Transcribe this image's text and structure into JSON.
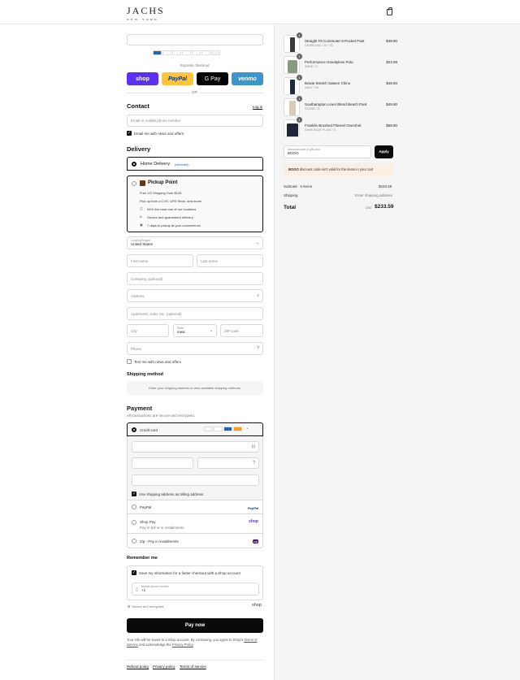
{
  "header": {
    "logo_main": "JACHS",
    "logo_sub": "NEW YORK"
  },
  "express": {
    "label": "Express checkout",
    "shop": "shop",
    "paypal": "PayPal",
    "gpay": "G Pay",
    "venmo": "venmo",
    "or": "OR"
  },
  "contact": {
    "title": "Contact",
    "login": "Log in",
    "email_placeholder": "Email or mobile phone number",
    "news_label": "Email me with news and offers"
  },
  "delivery": {
    "title": "Delivery",
    "home_label": "Home Delivery",
    "home_selected": "(selected)",
    "pickup_label": "Pickup Point",
    "pickup_line1": "Free US Shipping Over $125",
    "pickup_line2": "Pick up from a CVS, UPS Store, and more!",
    "pickup_b1": "94% live near one of our locations",
    "pickup_b2": "Secure and guaranteed delivery",
    "pickup_b3": "7 days to pickup at your convenience",
    "country_label": "Country/Region",
    "country_value": "United States",
    "first_name": "First name",
    "last_name": "Last name",
    "company": "Company (optional)",
    "address": "Address",
    "apartment": "Apartment, suite, etc. (optional)",
    "city": "City",
    "state_label": "State",
    "state_value": "Iowa",
    "zip": "ZIP code",
    "phone": "Phone",
    "text_label": "Text me with news and offers"
  },
  "shipping": {
    "title": "Shipping method",
    "note": "Enter your shipping address to view available shipping methods."
  },
  "payment": {
    "title": "Payment",
    "subtitle": "All transactions are secure and encrypted.",
    "credit_card": "Credit card",
    "billing_label": "Use shipping address as billing address",
    "paypal": "PayPal",
    "paypal_logo": "PayPal",
    "shoppay": "Shop Pay",
    "shoppay_sub": "Pay in full or in installments",
    "shoppay_logo": "shop",
    "zip": "Zip - Pay in installments",
    "zip_logo": "zip"
  },
  "remember": {
    "title": "Remember me",
    "save_label": "Save my information for a faster checkout with a Shop account",
    "mobile_label": "Mobile phone number",
    "mobile_value": "+1",
    "secure": "Secure and encrypted",
    "shop": "shop"
  },
  "pay_button": "Pay now",
  "legal": {
    "line1": "Your info will be saved to a Shop account. By continuing, you agree to Shop's",
    "tos": "Terms of Service",
    "and": "and acknowledge the",
    "privacy": "Privacy Policy",
    "period": "."
  },
  "footer": {
    "refund": "Refund policy",
    "privacy": "Privacy policy",
    "terms": "Terms of service"
  },
  "cart": {
    "items": [
      {
        "qty": "1",
        "name": "Straight Fit Commuter 5-Pocket Pant",
        "variant": "CHARCOAL / 30 / 30",
        "price": "$49.90",
        "color": "#3a3a3a"
      },
      {
        "qty": "1",
        "name": "Performance Gravityless Polo",
        "variant": "SAGE / S",
        "price": "$23.99",
        "color": "#8a9a80"
      },
      {
        "qty": "1",
        "name": "Bowie Stretch Sateen Chino",
        "variant": "NAVY / 29",
        "price": "$49.90",
        "color": "#1f2a3d"
      },
      {
        "qty": "1",
        "name": "Southampton Linen Blend Beach Pant",
        "variant": "STONE / S",
        "price": "$49.90",
        "color": "#d8ccb8"
      },
      {
        "qty": "1",
        "name": "Franklin Brushed Flannel Overshirt",
        "variant": "DARK BLUE PLAID / S",
        "price": "$59.90",
        "color": "#1e2535"
      }
    ],
    "discount_label": "Discount code or gift card",
    "discount_value": "BOGO",
    "apply": "Apply",
    "error_code": "BOGO",
    "error_text": "discount code isn't valid for the items in your cart",
    "subtotal_label": "Subtotal · 5 items",
    "subtotal_value": "$233.59",
    "shipping_label": "Shipping",
    "shipping_value": "Enter shipping address",
    "total_label": "Total",
    "currency": "USD",
    "total_value": "$233.59"
  }
}
